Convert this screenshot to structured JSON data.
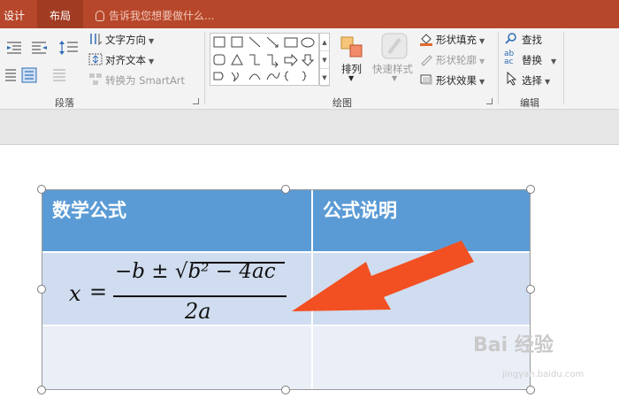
{
  "tabs": {
    "design": "设计",
    "layout": "布局"
  },
  "tell_me": "告诉我您想要做什么...",
  "ribbon": {
    "paragraph": {
      "text_direction": "文字方向",
      "align_text": "对齐文本",
      "convert_smartart": "转换为 SmartArt",
      "label": "段落"
    },
    "drawing": {
      "arrange": "排列",
      "quick_styles": "快速样式",
      "shape_fill": "形状填充",
      "shape_outline": "形状轮廓",
      "shape_effects": "形状效果",
      "label": "绘图"
    },
    "editing": {
      "find": "查找",
      "replace": "替换",
      "select": "选择",
      "label": "编辑"
    }
  },
  "table": {
    "header": [
      "数学公式",
      "公式说明"
    ]
  },
  "formula": {
    "x": "x",
    "eq": "=",
    "numerator_prefix": "−b ± ",
    "radicand": "b² − 4ac",
    "denominator": "2a"
  },
  "watermark": {
    "logo": "Bai 经验",
    "url": "jingyan.baidu.com"
  },
  "colors": {
    "title_bar": "#b7472a",
    "table_header": "#5b9bd5",
    "table_row_1": "#d0dcef",
    "table_row_2": "#e9eef7",
    "arrow": "#f25022"
  }
}
